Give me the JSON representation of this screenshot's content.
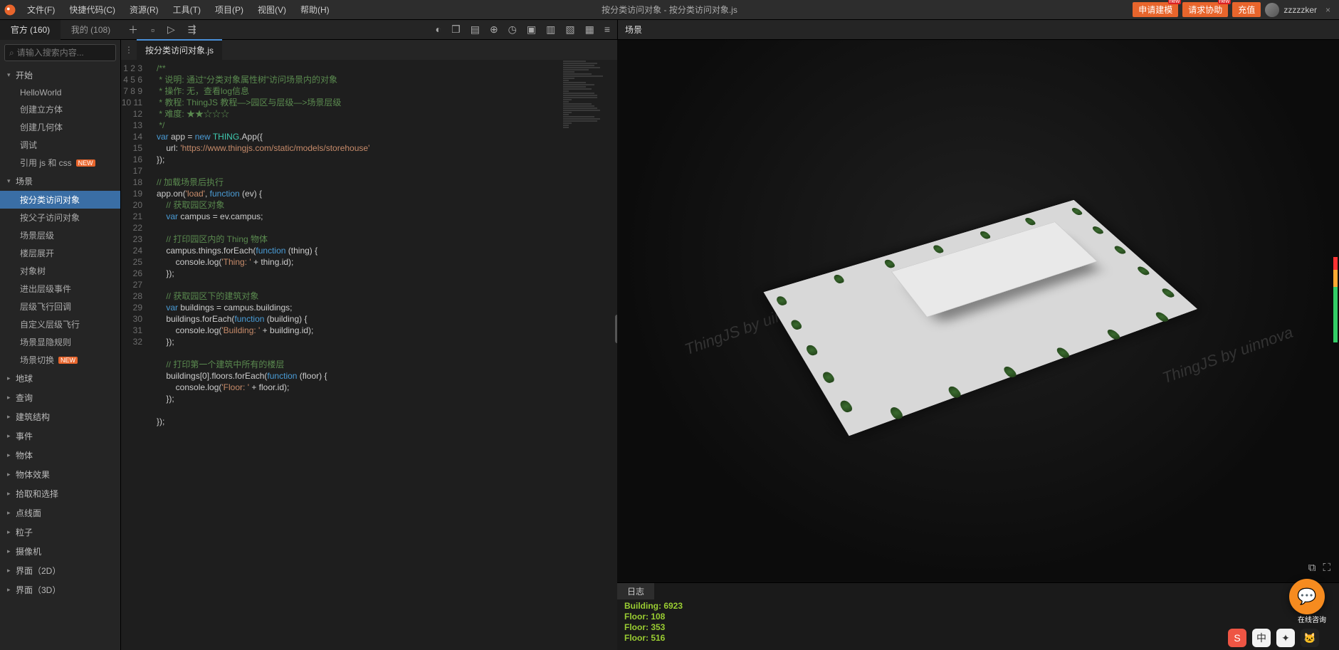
{
  "menu": {
    "items": [
      "文件(F)",
      "快捷代码(C)",
      "资源(R)",
      "工具(T)",
      "项目(P)",
      "视图(V)",
      "帮助(H)"
    ]
  },
  "window_title": "按分类访问对象 - 按分类访问对象.js",
  "top_right": {
    "btn1": "申请建模",
    "btn2": "请求协助",
    "btn3": "充值",
    "new": "new",
    "user": "zzzzzker"
  },
  "left_tabs": {
    "a": "官方 (160)",
    "b": "我的 (108)"
  },
  "search_placeholder": "请输入搜索内容...",
  "scene_header": "场景",
  "tree": [
    {
      "type": "group",
      "label": "开始",
      "open": true,
      "items": [
        {
          "label": "HelloWorld"
        },
        {
          "label": "创建立方体"
        },
        {
          "label": "创建几何体"
        },
        {
          "label": "调试"
        },
        {
          "label": "引用 js 和 css",
          "new": true
        }
      ]
    },
    {
      "type": "group",
      "label": "场景",
      "open": true,
      "items": [
        {
          "label": "按分类访问对象",
          "active": true
        },
        {
          "label": "按父子访问对象"
        },
        {
          "label": "场景层级"
        },
        {
          "label": "楼层展开"
        },
        {
          "label": "对象树"
        },
        {
          "label": "进出层级事件"
        },
        {
          "label": "层级飞行回调"
        },
        {
          "label": "自定义层级飞行"
        },
        {
          "label": "场景显隐规则"
        },
        {
          "label": "场景切换",
          "new": true
        }
      ]
    },
    {
      "type": "group",
      "label": "地球"
    },
    {
      "type": "group",
      "label": "查询"
    },
    {
      "type": "group",
      "label": "建筑结构"
    },
    {
      "type": "group",
      "label": "事件"
    },
    {
      "type": "group",
      "label": "物体"
    },
    {
      "type": "group",
      "label": "物体效果"
    },
    {
      "type": "group",
      "label": "拾取和选择"
    },
    {
      "type": "group",
      "label": "点线面"
    },
    {
      "type": "group",
      "label": "粒子"
    },
    {
      "type": "group",
      "label": "摄像机"
    },
    {
      "type": "group",
      "label": "界面（2D）"
    },
    {
      "type": "group",
      "label": "界面（3D）"
    }
  ],
  "file_tab": "按分类访问对象.js",
  "code": {
    "desc": " * 说明: 通过“分类对象属性树”访问场景内的对象",
    "op": " * 操作: 无，查看log信息",
    "tut": " * 教程: ThingJS 教程—>园区与层级—>场景层级",
    "diff": " * 难度: ★★☆☆☆",
    "url": "'https://www.thingjs.com/static/models/storehouse'",
    "c_load": "// 加载场景后执行",
    "c_campus": "// 获取园区对象",
    "c_things": "// 打印园区内的 Thing 物体",
    "s_thing": "'Thing: '",
    "c_bldg": "// 获取园区下的建筑对象",
    "s_bldg": "'Building: '",
    "c_floor": "// 打印第一个建筑中所有的楼层",
    "s_floor": "'Floor: '"
  },
  "log": {
    "tab": "日志",
    "lines": [
      "Building: 6923",
      "Floor: 108",
      "Floor: 353",
      "Floor: 516"
    ]
  },
  "watermark": "ThingJS by uinnova",
  "chat": "在线咨询"
}
